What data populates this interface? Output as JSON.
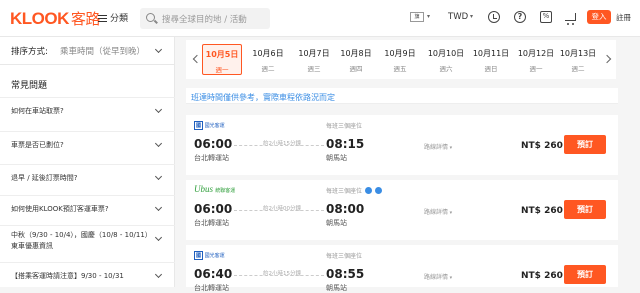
{
  "header": {
    "logo_text": "KLOOK",
    "logo_cn": "客路",
    "category_label": "分類",
    "search_placeholder": "搜尋全球目的地 / 活動",
    "flag_label": "旗",
    "currency": "TWD",
    "login_label": "登入",
    "signup_label": "註冊",
    "icons": [
      "hamburger-icon",
      "search-icon",
      "flag-icon",
      "clock-icon",
      "help-icon",
      "coupon-icon",
      "cart-icon"
    ],
    "accent_color": "#ff5722"
  },
  "sidebar": {
    "sort_label": "排序方式:",
    "sort_value": "乘車時間（從早到晚）",
    "faq_title": "常見問題",
    "faq_items": [
      "如何在車站取票?",
      "車票是否已劃位?",
      "退早 / 延後訂票時間?",
      "如何使用KLOOK預訂客運車票?",
      "中秋（9/30 - 10/4），國慶（10/8 - 10/11）東車優惠資訊",
      "【搭乘客運時請注意】9/30 - 10/31"
    ]
  },
  "dates": [
    {
      "date": "10月5日",
      "weekday": "週一",
      "selected": true
    },
    {
      "date": "10月6日",
      "weekday": "週二",
      "selected": false
    },
    {
      "date": "10月7日",
      "weekday": "週三",
      "selected": false
    },
    {
      "date": "10月8日",
      "weekday": "週四",
      "selected": false
    },
    {
      "date": "10月9日",
      "weekday": "週五",
      "selected": false
    },
    {
      "date": "10月10日",
      "weekday": "週六",
      "selected": false
    },
    {
      "date": "10月11日",
      "weekday": "週日",
      "selected": false
    },
    {
      "date": "10月12日",
      "weekday": "週一",
      "selected": false
    },
    {
      "date": "10月13日",
      "weekday": "週二",
      "selected": false
    }
  ],
  "notice": "班達時間僅供參考，實際車程依路況而定",
  "trips": [
    {
      "operator": "國光客運",
      "first_depart_note": "每班三個座位",
      "depart_time": "06:00",
      "depart_station": "台北轉運站",
      "duration": "約2小時15分鐘",
      "arrive_time": "08:15",
      "arrive_station": "朝馬站",
      "detail_label": "路線詳情",
      "price": "NT$ 260",
      "book_label": "預訂"
    },
    {
      "operator": "Ubus",
      "operator_sub": "統聯客運",
      "first_depart_note": "每班三個座位",
      "depart_time": "06:00",
      "depart_station": "台北轉運站",
      "duration": "約2小時00分鐘",
      "arrive_time": "08:00",
      "arrive_station": "朝馬站",
      "detail_label": "路線詳情",
      "price": "NT$ 260",
      "book_label": "預訂"
    },
    {
      "operator": "國光客運",
      "first_depart_note": "每班三個座位",
      "depart_time": "06:40",
      "depart_station": "台北轉運站",
      "duration": "約2小時15分鐘",
      "arrive_time": "08:55",
      "arrive_station": "朝馬站",
      "detail_label": "路線詳情",
      "price": "NT$ 260",
      "book_label": "預訂"
    }
  ]
}
